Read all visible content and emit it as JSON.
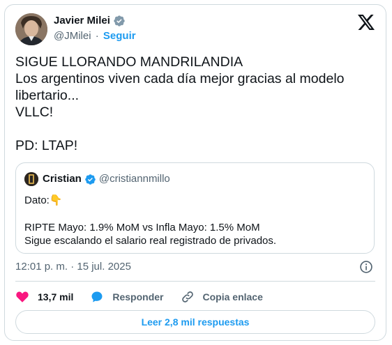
{
  "author": {
    "name": "Javier Milei",
    "handle": "@JMilei",
    "separator": "·",
    "follow_label": "Seguir"
  },
  "tweet": {
    "text": "SIGUE LLORANDO MANDRILANDIA\nLos argentinos viven cada día mejor gracias al modelo libertario...\nVLLC!\n\nPD: LTAP!",
    "timestamp": "12:01 p. m. · 15 jul. 2025"
  },
  "quote": {
    "name": "Cristian",
    "handle": "@cristiannmillo",
    "line1": "Dato:👇",
    "line2": "RIPTE Mayo: 1.9% MoM vs Infla Mayo: 1.5% MoM",
    "line3": "Sigue escalando el salario real registrado de privados."
  },
  "actions": {
    "likes": "13,7 mil",
    "reply_label": "Responder",
    "copy_label": "Copia enlace"
  },
  "replies_button": "Leer 2,8 mil respuestas",
  "colors": {
    "accent": "#1d9bf0",
    "like": "#f91880",
    "text": "#0f1419",
    "muted": "#536471",
    "border": "#cfd9de"
  }
}
